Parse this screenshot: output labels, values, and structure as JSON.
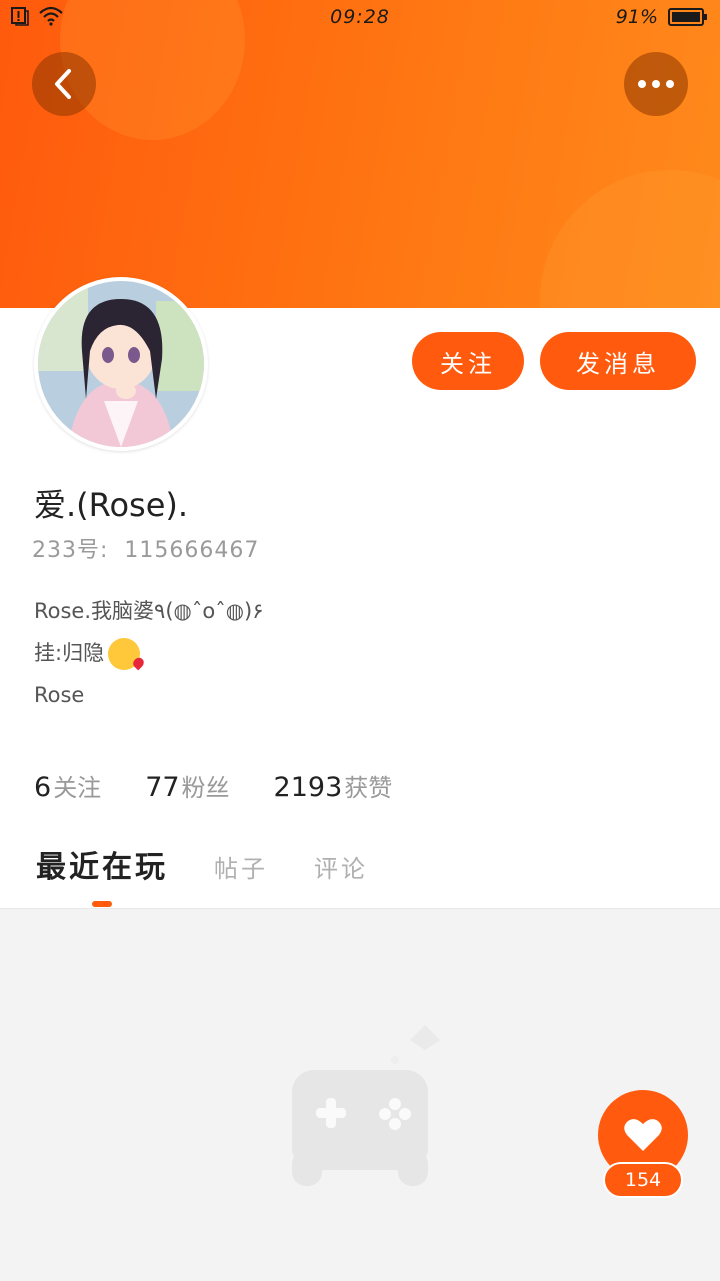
{
  "status_bar": {
    "time": "09:28",
    "battery": "91%"
  },
  "header": {
    "back_icon": "chevron-left-icon",
    "more_icon": "more-horizontal-icon"
  },
  "profile": {
    "name": "爱.(Rose).",
    "id_label": "233号:",
    "id_value": "115666467",
    "bio": [
      "Rose.我脑婆٩(◍ˆoˆ◍)۶",
      "挂:归隐",
      "Rose"
    ],
    "bio_emoji": "kissing-face-with-heart-emoji"
  },
  "actions": {
    "follow": "关注",
    "message": "发消息"
  },
  "stats": [
    {
      "value": "6",
      "label": "关注"
    },
    {
      "value": "77",
      "label": "粉丝"
    },
    {
      "value": "2193",
      "label": "获赞"
    }
  ],
  "tabs": [
    {
      "label": "最近在玩",
      "active": true
    },
    {
      "label": "帖子",
      "active": false
    },
    {
      "label": "评论",
      "active": false
    }
  ],
  "empty_state": {
    "icon": "gamepad-icon"
  },
  "like": {
    "count": "154",
    "icon": "heart-icon"
  },
  "colors": {
    "accent": "#ff5a0d",
    "header_gradient_end": "#ff8a1c"
  }
}
